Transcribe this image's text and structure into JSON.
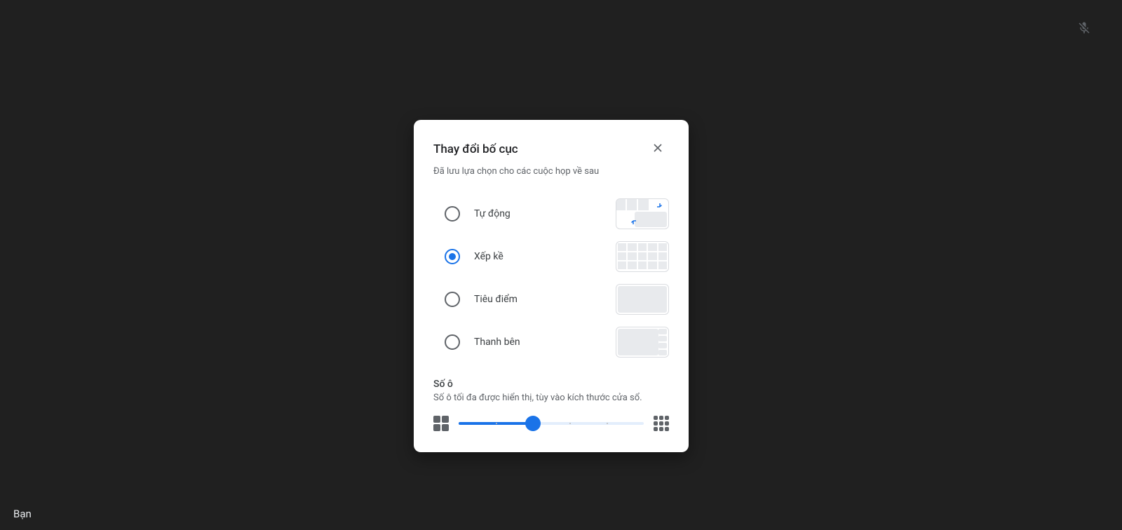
{
  "self_label": "Bạn",
  "dialog": {
    "title": "Thay đổi bố cục",
    "subtitle": "Đã lưu lựa chọn cho các cuộc họp về sau",
    "options": [
      {
        "id": "auto",
        "label": "Tự động",
        "selected": false
      },
      {
        "id": "tiled",
        "label": "Xếp kề",
        "selected": true
      },
      {
        "id": "spotlight",
        "label": "Tiêu điểm",
        "selected": false
      },
      {
        "id": "sidebar",
        "label": "Thanh bên",
        "selected": false
      }
    ],
    "tiles": {
      "heading": "Số ô",
      "description": "Số ô tối đa được hiển thị, tùy vào kích thước cửa sổ.",
      "slider_percent": 40
    }
  },
  "icons": {
    "mic_muted": "mic-muted-icon",
    "close": "close-icon"
  }
}
